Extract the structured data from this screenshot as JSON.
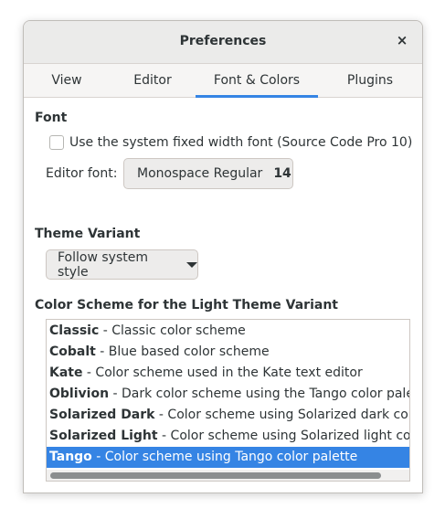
{
  "window": {
    "title": "Preferences",
    "close_glyph": "×"
  },
  "tabs": [
    {
      "label": "View"
    },
    {
      "label": "Editor"
    },
    {
      "label": "Font & Colors",
      "active": true
    },
    {
      "label": "Plugins"
    }
  ],
  "font_section": {
    "title": "Font",
    "system_font_checkbox": {
      "label": "Use the system fixed width font (Source Code Pro 10)",
      "checked": false
    },
    "editor_font_label": "Editor font:",
    "editor_font_name": "Monospace Regular",
    "editor_font_size": "14"
  },
  "theme_section": {
    "title": "Theme Variant",
    "selected": "Follow system style"
  },
  "scheme_section": {
    "title": "Color Scheme for the Light Theme Variant",
    "schemes": [
      {
        "name": "Classic",
        "description": " - Classic color scheme"
      },
      {
        "name": "Cobalt",
        "description": " - Blue based color scheme"
      },
      {
        "name": "Kate",
        "description": " - Color scheme used in the Kate text editor"
      },
      {
        "name": "Oblivion",
        "description": " - Dark color scheme using the Tango color palette"
      },
      {
        "name": "Solarized Dark",
        "description": " - Color scheme using Solarized dark color pale"
      },
      {
        "name": "Solarized Light",
        "description": " - Color scheme using Solarized light color pal"
      },
      {
        "name": "Tango",
        "description": " - Color scheme using Tango color palette",
        "selected": true
      }
    ]
  },
  "colors": {
    "accent": "#3584e4",
    "window_bg": "#f6f5f4"
  }
}
